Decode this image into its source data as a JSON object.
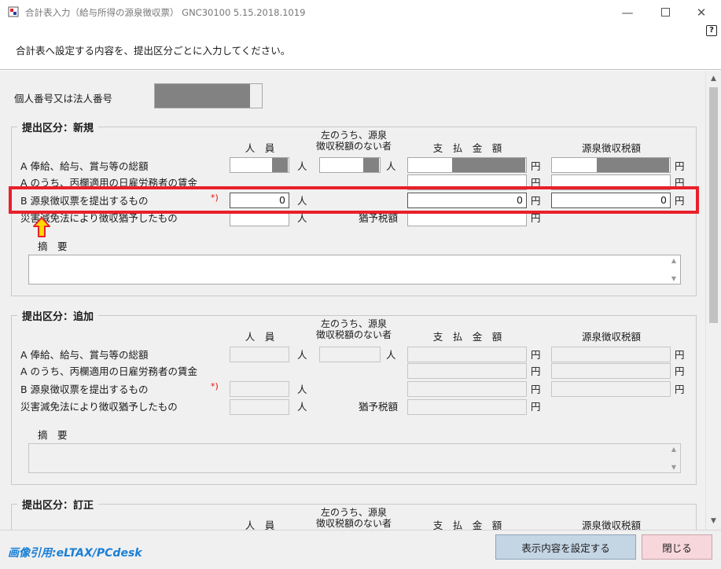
{
  "window": {
    "title": "合計表入力（給与所得の源泉徴収票）  GNC30100  5.15.2018.1019",
    "help": "?"
  },
  "instruction": "合計表へ設定する内容を、提出区分ごとに入力してください。",
  "individual_number_label": "個人番号又は法人番号",
  "columns": {
    "persons": "人　員",
    "no_withholding_line1": "左のうち、源泉",
    "no_withholding_line2": "徴収税額のない者",
    "payment": "支　払　金　額",
    "withholding": "源泉徴収税額"
  },
  "units": {
    "person": "人",
    "yen": "円"
  },
  "required_mark": "*)",
  "deferred_label": "猶予税額",
  "memo_label": "摘　要",
  "rows": {
    "a1": "A  俸給、給与、賞与等の総額",
    "a2": "A  のうち、丙欄適用の日雇労務者の賃金",
    "b": "B  源泉徴収票を提出するもの",
    "d": "災害減免法により徴収猶予したもの"
  },
  "sections": [
    {
      "title": "提出区分：新規",
      "b_persons": "0",
      "b_payment": "0",
      "b_withholding": "0"
    },
    {
      "title": "提出区分：追加"
    },
    {
      "title": "提出区分：訂正"
    }
  ],
  "buttons": {
    "set": "表示内容を設定する",
    "close": "閉じる"
  },
  "credit": "画像引用:eLTAX/PCdesk",
  "colors": {
    "highlight": "#e8202a",
    "arrow": "#ffd800",
    "set_button": "#c4d5e4",
    "close_button": "#f7d7dc"
  }
}
